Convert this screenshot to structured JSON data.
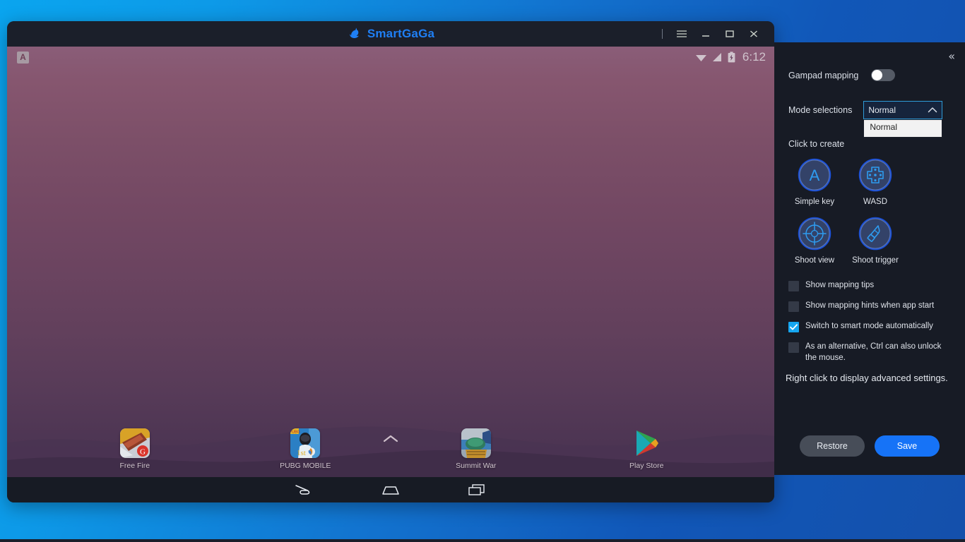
{
  "app": {
    "title": "SmartGaGa",
    "logo_icon": "swan-logo-icon",
    "brand_color": "#1f7ff5"
  },
  "titlebar": {
    "menu_icon": "hamburger-menu-icon",
    "minimize_icon": "minimize-icon",
    "maximize_icon": "maximize-icon",
    "close_icon": "close-icon"
  },
  "android": {
    "status": {
      "app_badge_letter": "A",
      "wifi_icon": "wifi-icon",
      "signal_icon": "cell-signal-icon",
      "battery_icon": "battery-charging-icon",
      "time": "6:12"
    },
    "drawer_arrow_icon": "chevron-up-icon",
    "dock": [
      {
        "label": "Free Fire",
        "icon": "free-fire-app-icon"
      },
      {
        "label": "PUBG MOBILE",
        "icon": "pubg-mobile-app-icon"
      },
      {
        "label": "Summit War",
        "icon": "summit-war-app-icon"
      },
      {
        "label": "Play Store",
        "icon": "google-play-store-icon"
      }
    ],
    "navbar": {
      "back_icon": "android-back-icon",
      "home_icon": "android-home-icon",
      "recents_icon": "android-recents-icon"
    }
  },
  "panel": {
    "collapse_icon": "double-chevron-left-icon",
    "gamepad_mapping": {
      "label": "Gampad mapping",
      "enabled": false
    },
    "mode_selections": {
      "label": "Mode selections",
      "value": "Normal",
      "caret_icon": "chevron-up-icon",
      "open": true,
      "options": [
        "Normal"
      ]
    },
    "create": {
      "title": "Click to create",
      "items": [
        {
          "label": "Simple key",
          "icon": "simple-key-icon"
        },
        {
          "label": "WASD",
          "icon": "wasd-dpad-icon"
        },
        {
          "label": "Shoot view",
          "icon": "shoot-view-crosshair-icon"
        },
        {
          "label": "Shoot trigger",
          "icon": "shoot-trigger-bullet-icon"
        }
      ]
    },
    "checkboxes": [
      {
        "label": "Show mapping tips",
        "checked": false
      },
      {
        "label": "Show mapping hints when app start",
        "checked": false
      },
      {
        "label": "Switch to smart mode automatically",
        "checked": true
      },
      {
        "label": "As an alternative, Ctrl can also unlock the mouse.",
        "checked": false
      }
    ],
    "advanced_note": "Right click to display advanced settings.",
    "buttons": {
      "restore": "Restore",
      "save": "Save"
    },
    "accent_color": "#16a6f0",
    "save_color": "#1673f7"
  }
}
